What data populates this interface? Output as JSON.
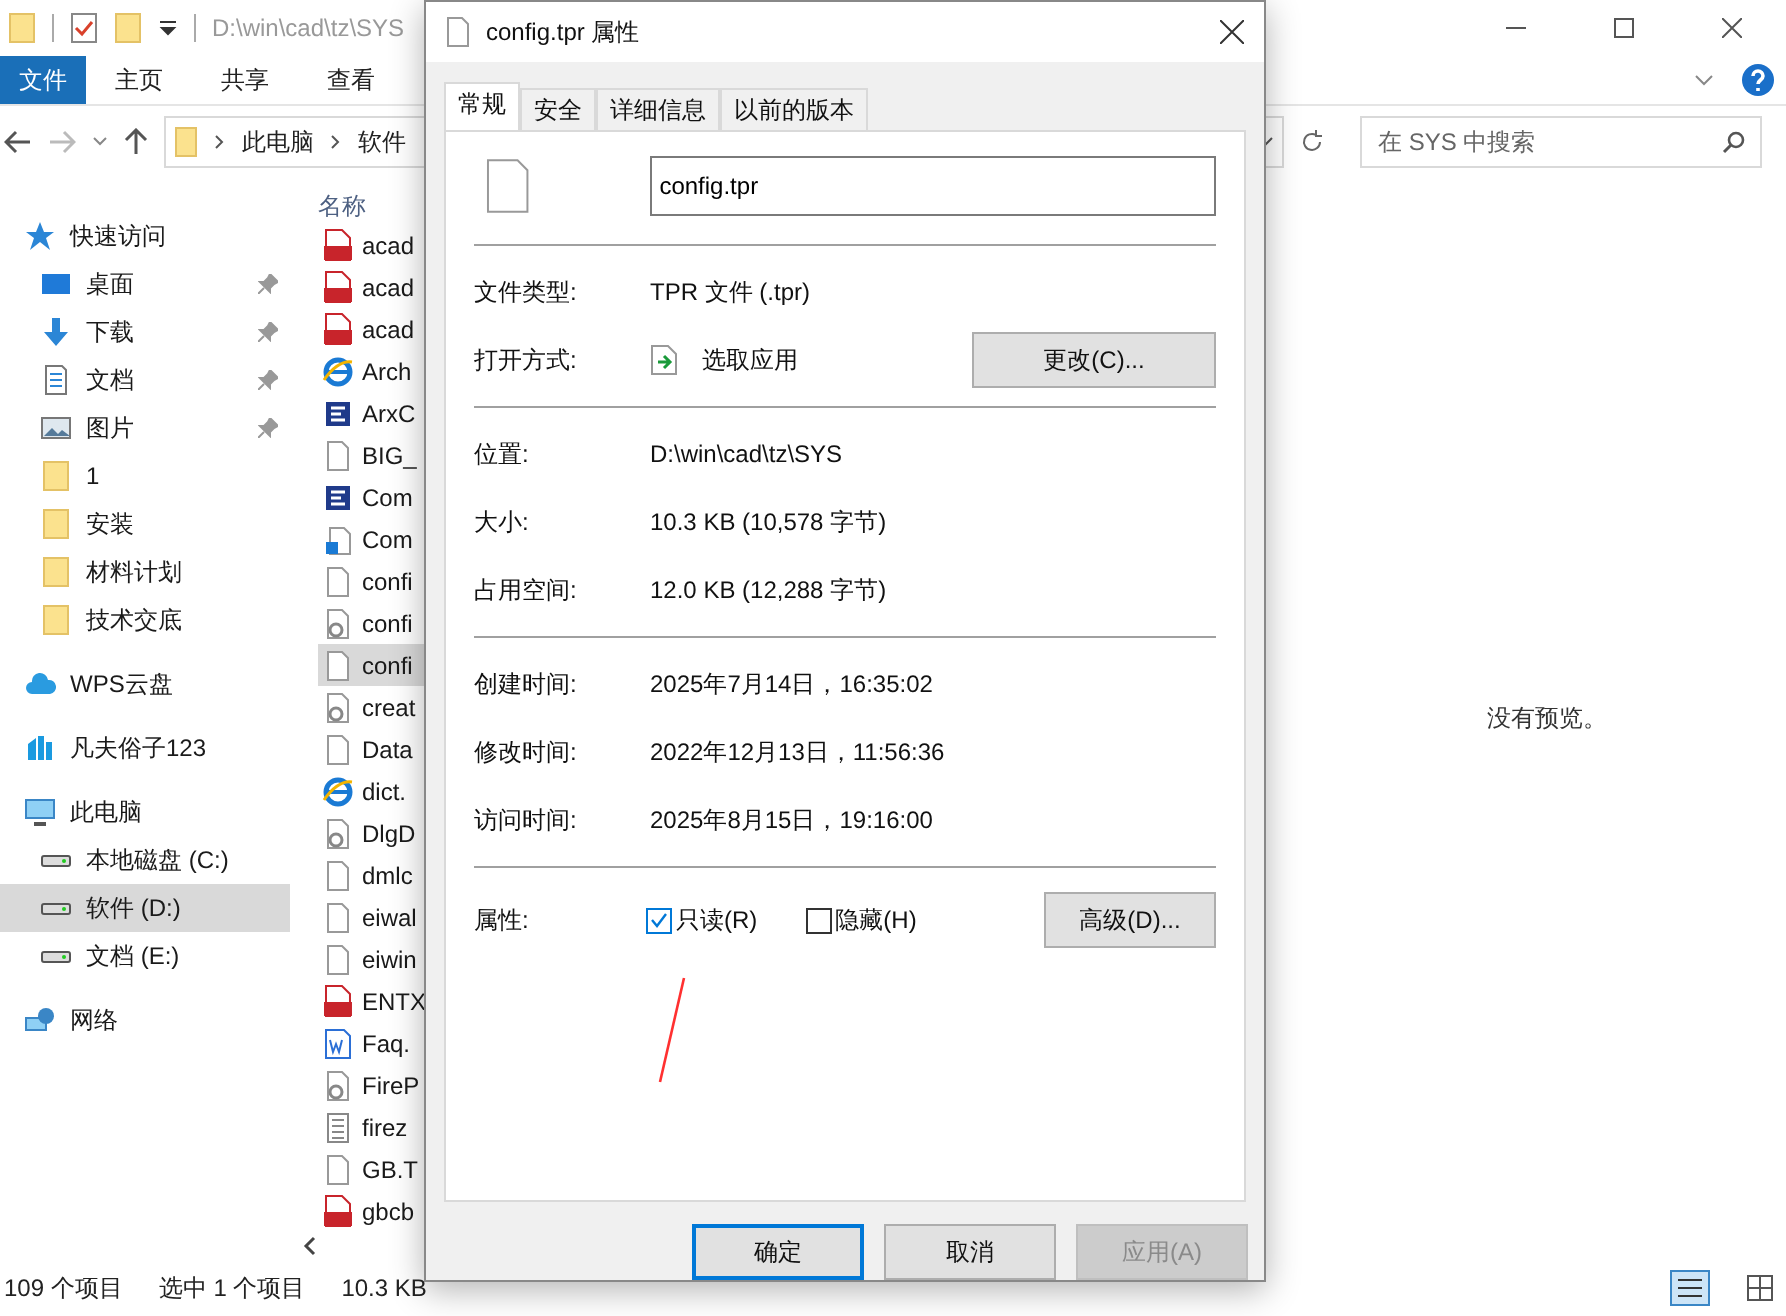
{
  "explorer": {
    "path_title": "D:\\win\\cad\\tz\\SYS",
    "ribbon_tabs": [
      {
        "label": "文件",
        "selected": true
      },
      {
        "label": "主页",
        "selected": false
      },
      {
        "label": "共享",
        "selected": false
      },
      {
        "label": "查看",
        "selected": false
      }
    ],
    "address": [
      "此电脑",
      "软件"
    ],
    "search": {
      "placeholder": "在 SYS 中搜索"
    },
    "column_header": "名称",
    "sidebar": [
      {
        "label": "快速访问",
        "kind": "star",
        "selected": false,
        "children": [
          {
            "label": "桌面",
            "kind": "desktop",
            "pinned": true,
            "selected": false
          },
          {
            "label": "下载",
            "kind": "download",
            "pinned": true,
            "selected": false
          },
          {
            "label": "文档",
            "kind": "document",
            "pinned": true,
            "selected": false
          },
          {
            "label": "图片",
            "kind": "image",
            "pinned": true,
            "selected": false
          },
          {
            "label": "1",
            "kind": "folder",
            "pinned": false,
            "selected": false
          },
          {
            "label": "安装",
            "kind": "folder",
            "pinned": false,
            "selected": false
          },
          {
            "label": "材料计划",
            "kind": "folder",
            "pinned": false,
            "selected": false
          },
          {
            "label": "技术交底",
            "kind": "folder",
            "pinned": false,
            "selected": false
          }
        ]
      },
      {
        "label": "WPS云盘",
        "kind": "cloud",
        "selected": false
      },
      {
        "label": "凡夫俗子123",
        "kind": "app",
        "selected": false
      },
      {
        "label": "此电脑",
        "kind": "pc",
        "selected": false,
        "children": [
          {
            "label": "本地磁盘 (C:)",
            "kind": "drive",
            "pinned": false,
            "selected": false
          },
          {
            "label": "软件 (D:)",
            "kind": "drive",
            "pinned": false,
            "selected": true
          },
          {
            "label": "文档 (E:)",
            "kind": "drive",
            "pinned": false,
            "selected": false
          }
        ]
      },
      {
        "label": "网络",
        "kind": "network",
        "selected": false
      }
    ],
    "files": [
      {
        "name": "acad",
        "kind": "pgp",
        "selected": false
      },
      {
        "name": "acad",
        "kind": "lsp",
        "selected": false
      },
      {
        "name": "acad",
        "kind": "pat",
        "selected": false
      },
      {
        "name": "Arch",
        "kind": "web",
        "selected": false
      },
      {
        "name": "ArxC",
        "kind": "arx",
        "selected": false
      },
      {
        "name": "BIG_",
        "kind": "blank",
        "selected": false
      },
      {
        "name": "Com",
        "kind": "arx",
        "selected": false
      },
      {
        "name": "Com",
        "kind": "setup",
        "selected": false
      },
      {
        "name": "confi",
        "kind": "blank",
        "selected": false
      },
      {
        "name": "confi",
        "kind": "gear",
        "selected": false
      },
      {
        "name": "confi",
        "kind": "blank",
        "selected": true
      },
      {
        "name": "creat",
        "kind": "gear",
        "selected": false
      },
      {
        "name": "Data",
        "kind": "blank",
        "selected": false
      },
      {
        "name": "dict.",
        "kind": "web",
        "selected": false
      },
      {
        "name": "DlgD",
        "kind": "gear",
        "selected": false
      },
      {
        "name": "dmlc",
        "kind": "blank",
        "selected": false
      },
      {
        "name": "eiwal",
        "kind": "blank",
        "selected": false
      },
      {
        "name": "eiwin",
        "kind": "blank",
        "selected": false
      },
      {
        "name": "ENTX",
        "kind": "lsp",
        "selected": false
      },
      {
        "name": "Faq.",
        "kind": "word",
        "selected": false
      },
      {
        "name": "FireP",
        "kind": "gear",
        "selected": false
      },
      {
        "name": "firez",
        "kind": "text",
        "selected": false
      },
      {
        "name": "GB.T",
        "kind": "blank",
        "selected": false
      },
      {
        "name": "gbcb",
        "kind": "shx",
        "selected": false
      }
    ],
    "preview": "没有预览。",
    "status": [
      "109 个项目",
      "选中 1 个项目",
      "10.3 KB"
    ]
  },
  "dialog": {
    "title": "config.tpr 属性",
    "tabs": [
      {
        "label": "常规",
        "selected": true
      },
      {
        "label": "安全",
        "selected": false
      },
      {
        "label": "详细信息",
        "selected": false
      },
      {
        "label": "以前的版本",
        "selected": false
      }
    ],
    "filename": "config.tpr",
    "type_label": "文件类型:",
    "type_value": "TPR 文件 (.tpr)",
    "open_label": "打开方式:",
    "open_value": "选取应用",
    "change_button": "更改(C)...",
    "location": [
      {
        "label": "位置:",
        "value": "D:\\win\\cad\\tz\\SYS"
      },
      {
        "label": "大小:",
        "value": "10.3 KB (10,578 字节)"
      },
      {
        "label": "占用空间:",
        "value": "12.0 KB (12,288 字节)"
      }
    ],
    "times": [
      {
        "label": "创建时间:",
        "value": "2025年7月14日，16:35:02"
      },
      {
        "label": "修改时间:",
        "value": "2022年12月13日，11:56:36"
      },
      {
        "label": "访问时间:",
        "value": "2025年8月15日，19:16:00"
      }
    ],
    "attributes_label": "属性:",
    "attributes": [
      {
        "label": "只读(R)",
        "checked": true
      },
      {
        "label": "隐藏(H)",
        "checked": false
      }
    ],
    "advanced_button": "高级(D)...",
    "buttons": [
      {
        "label": "确定",
        "kind": "default",
        "disabled": false
      },
      {
        "label": "取消",
        "kind": "normal",
        "disabled": false
      },
      {
        "label": "应用(A)",
        "kind": "normal",
        "disabled": true
      }
    ]
  }
}
